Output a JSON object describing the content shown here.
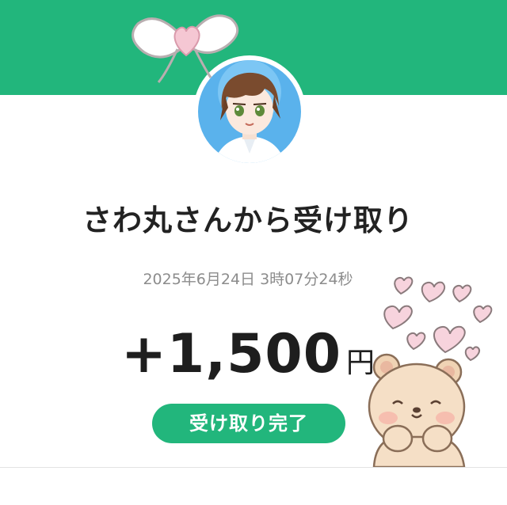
{
  "transfer": {
    "title": "さわ丸さんから受け取り",
    "timestamp": "2025年6月24日 3時07分24秒",
    "amount": "+1,500",
    "currency": "円",
    "status": "受け取り完了"
  },
  "colors": {
    "brand_green": "#22b67c",
    "text_dark": "#222222",
    "text_gray": "#8c8c8c"
  },
  "icons": {
    "avatar": "anime-character-avatar",
    "ribbon": "heart-ribbon-sticker",
    "hearts": "floating-hearts-sticker",
    "bear": "bear-sticker"
  }
}
